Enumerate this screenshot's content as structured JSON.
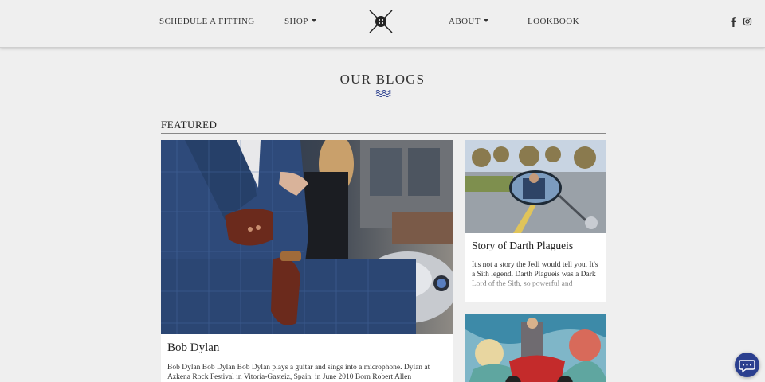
{
  "nav": {
    "left": [
      {
        "label": "SCHEDULE A FITTING"
      },
      {
        "label": "SHOP",
        "has_dropdown": true
      }
    ],
    "right": [
      {
        "label": "ABOUT",
        "has_dropdown": true
      },
      {
        "label": "LOOKBOOK"
      }
    ],
    "logo_icon": "crossed-needles-button-icon",
    "social": [
      "facebook-icon",
      "instagram-icon"
    ]
  },
  "page": {
    "title": "OUR BLOGS",
    "title_ornament": "wave-icon"
  },
  "featured": {
    "label": "FEATURED",
    "main": {
      "title": "Bob Dylan",
      "excerpt": "Bob Dylan Bob Dylan Bob Dylan plays a guitar and sings into a microphone. Dylan at Azkena Rock Festival in Vitoria-Gasteiz, Spain, in June 2010 Born Robert Allen Zimmerman",
      "image": "man-in-blue-suit-on-motorcycle-photo"
    },
    "side": [
      {
        "title": "Story of Darth Plagueis",
        "excerpt": "It's not a story the Jedi would tell you. It's a Sith legend. Darth Plagueis was a Dark Lord of the Sith, so powerful and",
        "image": "motorcycle-mirror-reflection-photo"
      },
      {
        "title": "",
        "excerpt": "",
        "image": "couple-on-red-motorcycle-mural-photo"
      }
    ]
  },
  "chat": {
    "icon": "chat-bubble-icon"
  },
  "colors": {
    "background": "#efefef",
    "accent": "#2b3f8f",
    "card": "#ffffff",
    "text": "#222222"
  }
}
